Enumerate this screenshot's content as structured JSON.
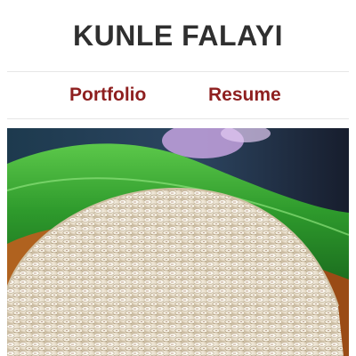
{
  "header": {
    "title": "KUNLE FALAYI"
  },
  "nav": {
    "items": [
      {
        "label": "Portfolio"
      },
      {
        "label": "Resume"
      }
    ]
  },
  "colors": {
    "title": "#2f2f2f",
    "nav_link": "#8e1f1f",
    "divider": "#e6e6e6",
    "background": "#ffffff"
  },
  "hero": {
    "subject": "mound of white rice on green leaf"
  }
}
